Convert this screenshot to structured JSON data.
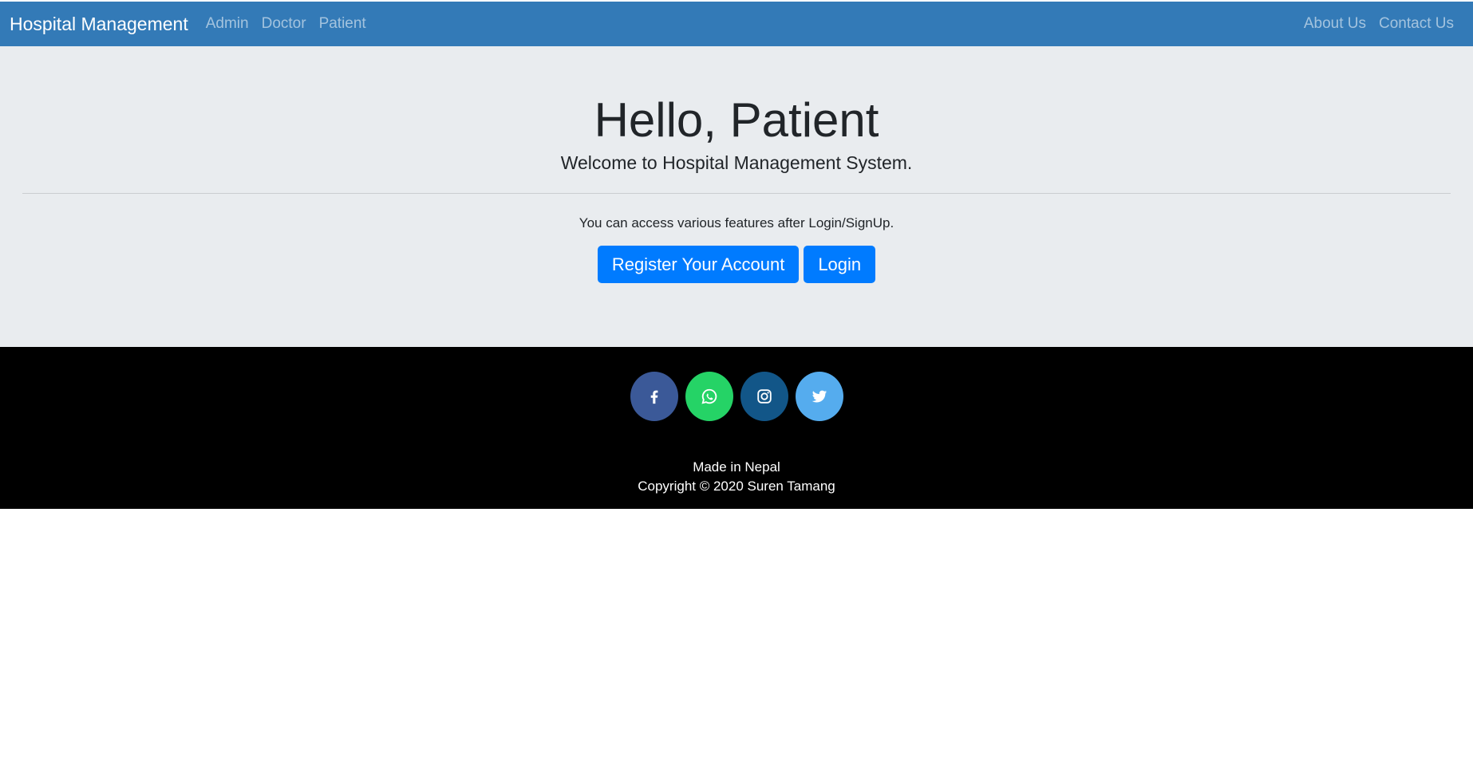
{
  "navbar": {
    "brand": "Hospital Management",
    "left_links": [
      "Admin",
      "Doctor",
      "Patient"
    ],
    "right_links": [
      "About Us",
      "Contact Us"
    ],
    "background": "#337ab7"
  },
  "hero": {
    "title": "Hello, Patient",
    "lead": "Welcome to Hospital Management System.",
    "note": "You can access various features after Login/SignUp.",
    "register_label": "Register Your Account",
    "login_label": "Login",
    "background": "#e9ecef",
    "button_color": "#007bff"
  },
  "footer": {
    "social": [
      {
        "icon": "facebook-icon",
        "color": "#3b5998"
      },
      {
        "icon": "whatsapp-icon",
        "color": "#25d366"
      },
      {
        "icon": "instagram-icon",
        "color": "#125688"
      },
      {
        "icon": "twitter-icon",
        "color": "#55acee"
      }
    ],
    "made_in": "Made in Nepal",
    "copyright": "Copyright © 2020 Suren Tamang",
    "background": "#000000"
  }
}
